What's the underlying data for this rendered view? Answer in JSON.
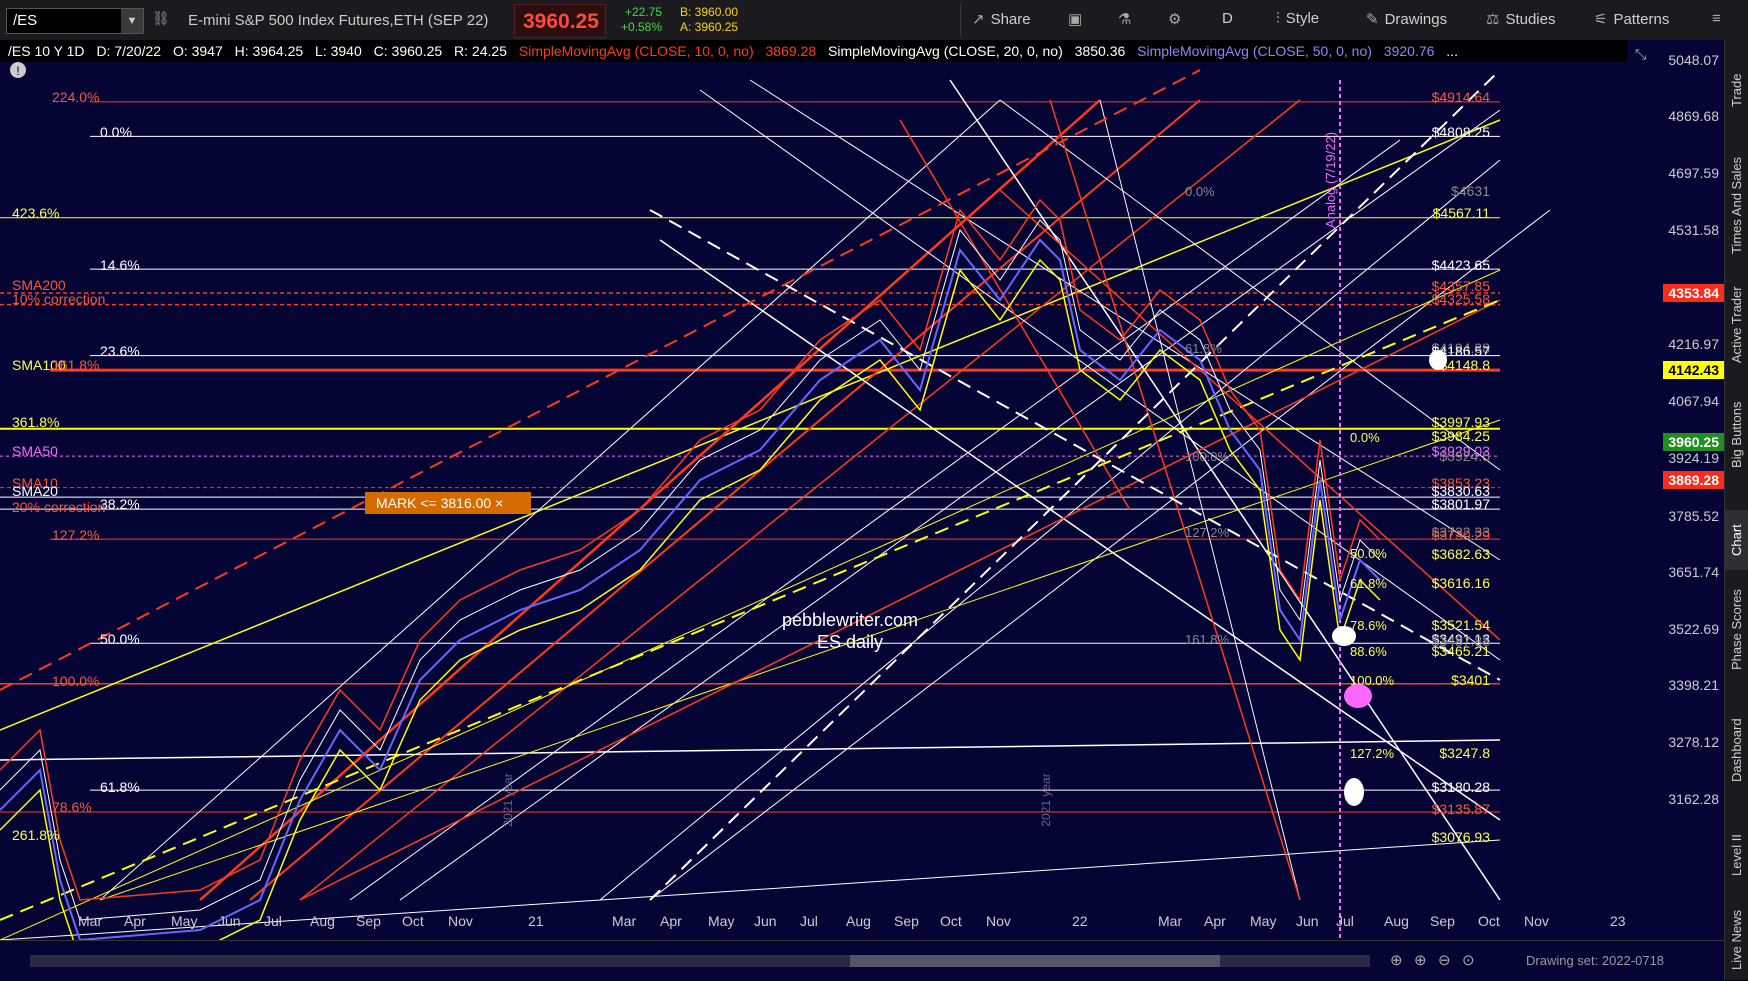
{
  "toolbar": {
    "symbol": "/ES",
    "dropdown_icon": "chevron-down-icon",
    "description": "E-mini S&P 500 Index Futures,ETH (SEP 22)",
    "last_price": "3960.25",
    "change": "+22.75",
    "change_pct": "+0.58%",
    "bid": "B: 3960.00",
    "ask": "A: 3960.25",
    "share": "Share",
    "period": "D",
    "style": "Style",
    "drawings": "Drawings",
    "studies": "Studies",
    "patterns": "Patterns"
  },
  "study_bar": {
    "header": "/ES 10 Y 1D",
    "date": "D: 7/20/22",
    "open": "O: 3947",
    "high": "H: 3964.25",
    "low": "L: 3940",
    "close": "C: 3960.25",
    "range": "R: 24.25",
    "sma10_label": "SimpleMovingAvg (CLOSE, 10, 0, no)",
    "sma10_value": "3869.28",
    "sma20_label": "SimpleMovingAvg (CLOSE, 20, 0, no)",
    "sma20_value": "3850.36",
    "sma50_label": "SimpleMovingAvg (CLOSE, 50, 0, no)",
    "sma50_value": "3920.76",
    "more": "..."
  },
  "price_axis": {
    "ticks": [
      "5048.07",
      "4869.68",
      "4697.59",
      "4531.58",
      "4216.97",
      "4067.94",
      "3924.19",
      "3785.52",
      "3651.74",
      "3522.69",
      "3398.21",
      "3278.12",
      "3162.28"
    ],
    "badges": [
      {
        "value": "4353.84",
        "bg": "#ff2a1a"
      },
      {
        "value": "4142.43",
        "bg": "#ffff00"
      },
      {
        "value": "3960.25",
        "bg": "#1f8f1f"
      },
      {
        "value": "3869.28",
        "bg": "#ff2a1a"
      }
    ]
  },
  "time_axis": {
    "labels": [
      "Mar",
      "Apr",
      "May",
      "Jun",
      "Jul",
      "Aug",
      "Sep",
      "Oct",
      "Nov",
      "21",
      "Mar",
      "Apr",
      "May",
      "Jun",
      "Jul",
      "Aug",
      "Sep",
      "Oct",
      "Nov",
      "22",
      "Mar",
      "Apr",
      "May",
      "Jun",
      "Jul",
      "Aug",
      "Sep",
      "Oct",
      "Nov",
      "23"
    ]
  },
  "left_fib_labels": [
    {
      "text": "224.0%",
      "color": "#ff5533"
    },
    {
      "text": "0.0%",
      "color": "#ffffff"
    },
    {
      "text": "423.6%",
      "color": "#ffff44"
    },
    {
      "text": "14.6%",
      "color": "#ffffff"
    },
    {
      "text": "SMA200",
      "color": "#ff5533"
    },
    {
      "text": "10% correction",
      "color": "#ff5533"
    },
    {
      "text": "23.6%",
      "color": "#ffffff"
    },
    {
      "text": "SMA100",
      "color": "#ffff44"
    },
    {
      "text": "161.8%",
      "color": "#ff5533"
    },
    {
      "text": "361.8%",
      "color": "#ffff44"
    },
    {
      "text": "SMA50",
      "color": "#ff66ff"
    },
    {
      "text": "SMA10",
      "color": "#ff5533"
    },
    {
      "text": "SMA20",
      "color": "#ffffff"
    },
    {
      "text": "38.2%",
      "color": "#ffffff"
    },
    {
      "text": "20% correction",
      "color": "#ff5533"
    },
    {
      "text": "127.2%",
      "color": "#ff5533"
    },
    {
      "text": "50.0%",
      "color": "#ffffff"
    },
    {
      "text": "100.0%",
      "color": "#ff5533"
    },
    {
      "text": "61.8%",
      "color": "#ffffff"
    },
    {
      "text": "78.6%",
      "color": "#ff5533"
    },
    {
      "text": "261.8%",
      "color": "#ffff44"
    }
  ],
  "right_price_labels": [
    {
      "text": "$4914.64",
      "color": "#ff5533"
    },
    {
      "text": "$4808.25",
      "color": "#ffffff"
    },
    {
      "text": "$4631",
      "color": "#888888"
    },
    {
      "text": "$4567.11",
      "color": "#ffff44"
    },
    {
      "text": "$4423.65",
      "color": "#ffffff"
    },
    {
      "text": "$4357.85",
      "color": "#ff5533"
    },
    {
      "text": "$4325.58",
      "color": "#ff5533"
    },
    {
      "text": "$4194.38",
      "color": "#888888"
    },
    {
      "text": "$4186.57",
      "color": "#ffffff"
    },
    {
      "text": "$4148.8",
      "color": "#ffff44"
    },
    {
      "text": "$3997.93",
      "color": "#ffff44"
    },
    {
      "text": "$3984.25",
      "color": "#ffff44"
    },
    {
      "text": "$3929.03",
      "color": "#ff66ff"
    },
    {
      "text": "$3924.5",
      "color": "#888888"
    },
    {
      "text": "$3853.23",
      "color": "#ff5533"
    },
    {
      "text": "$3830.63",
      "color": "#ffffff"
    },
    {
      "text": "$3801.97",
      "color": "#ffffff"
    },
    {
      "text": "$3732.33",
      "color": "#888888"
    },
    {
      "text": "$3730.29",
      "color": "#ff5533"
    },
    {
      "text": "$3682.63",
      "color": "#ffff44"
    },
    {
      "text": "$3616.16",
      "color": "#ffff44"
    },
    {
      "text": "$3521.54",
      "color": "#ffff44"
    },
    {
      "text": "$3491.13",
      "color": "#ffffff"
    },
    {
      "text": "$3487.88",
      "color": "#888888"
    },
    {
      "text": "$3465.21",
      "color": "#ffff44"
    },
    {
      "text": "$3401",
      "color": "#ffff44"
    },
    {
      "text": "$3247.8",
      "color": "#ffff44"
    },
    {
      "text": "$3180.28",
      "color": "#ffffff"
    },
    {
      "text": "$3135.87",
      "color": "#ff5533"
    },
    {
      "text": "$3076.93",
      "color": "#ffff44"
    }
  ],
  "mid_fib_labels": [
    {
      "text": "0.0%",
      "color": "#888888"
    },
    {
      "text": "61.8%",
      "color": "#888888"
    },
    {
      "text": "100.0%",
      "color": "#888888"
    },
    {
      "text": "127.2%",
      "color": "#888888"
    },
    {
      "text": "161.8%",
      "color": "#888888"
    },
    {
      "text": "0.0%",
      "color": "#ffff44"
    },
    {
      "text": "50.0%",
      "color": "#ffff44"
    },
    {
      "text": "61.8%",
      "color": "#ffff44"
    },
    {
      "text": "78.6%",
      "color": "#ffff44"
    },
    {
      "text": "88.6%",
      "color": "#ffff44"
    },
    {
      "text": "100.0%",
      "color": "#ffff44"
    },
    {
      "text": "127.2%",
      "color": "#ffff44"
    }
  ],
  "annotations": {
    "mark": "MARK <= 3816.00 ×",
    "watermark1": "pebblewriter.com",
    "watermark2": "ES daily",
    "analog": "Analog (7/19/22)",
    "year_2021": "2021 year",
    "year_2022": "2021 year"
  },
  "right_panel_tabs": [
    "Trade",
    "Times And Sales",
    "Active Trader",
    "Big Buttons",
    "Chart",
    "Phase Scores",
    "Dashboard",
    "Level II",
    "Live News"
  ],
  "bottom": {
    "drawing_set": "Drawing set: 2022-0718"
  },
  "colors": {
    "background": "#050535",
    "red": "#ff3a1a",
    "yellow": "#ffff00",
    "white": "#ffffff",
    "pink": "#ff66ff",
    "blue": "#6666ff"
  }
}
